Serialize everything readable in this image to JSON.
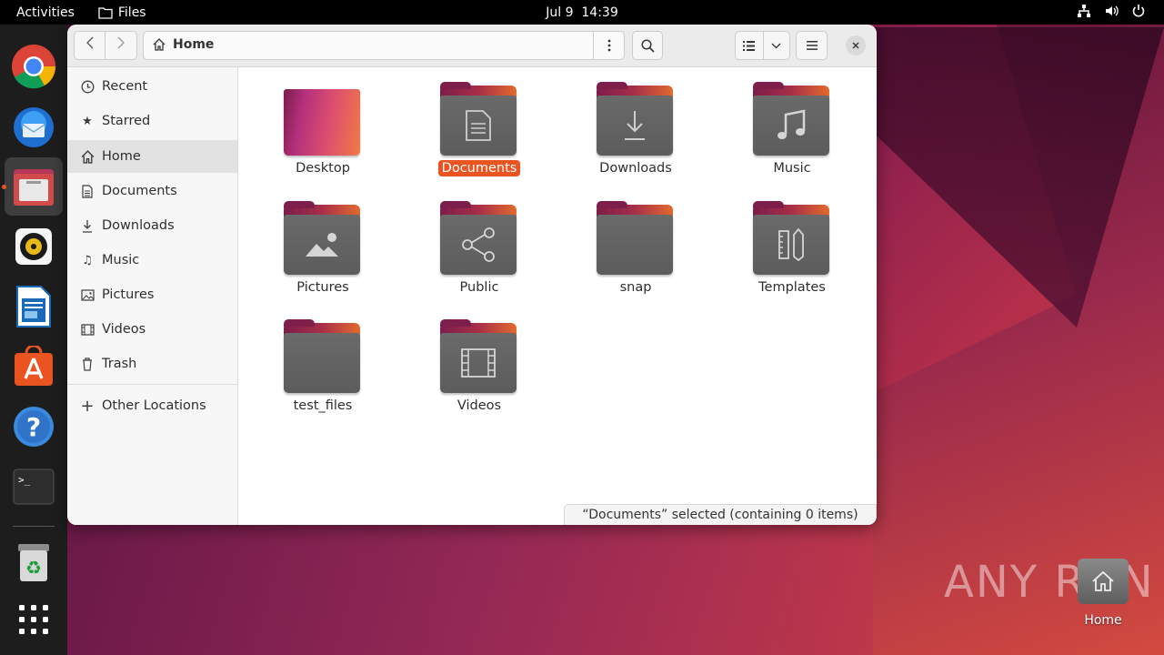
{
  "topbar": {
    "activities": "Activities",
    "app_name": "Files",
    "date": "Jul 9",
    "time": "14:39",
    "icons": [
      "network-icon",
      "volume-icon",
      "power-icon"
    ]
  },
  "dock": {
    "items": [
      "chrome",
      "thunderbird",
      "files",
      "rhythmbox",
      "libreoffice-writer",
      "app-center",
      "help",
      "terminal",
      "trash",
      "show-apps"
    ]
  },
  "window": {
    "path": "Home",
    "sidebar": [
      {
        "label": "Recent",
        "icon": "clock-icon"
      },
      {
        "label": "Starred",
        "icon": "star-icon"
      },
      {
        "label": "Home",
        "icon": "home-icon",
        "selected": true
      },
      {
        "label": "Documents",
        "icon": "document-icon"
      },
      {
        "label": "Downloads",
        "icon": "download-icon"
      },
      {
        "label": "Music",
        "icon": "music-icon"
      },
      {
        "label": "Pictures",
        "icon": "picture-icon"
      },
      {
        "label": "Videos",
        "icon": "video-icon"
      },
      {
        "label": "Trash",
        "icon": "trash-icon"
      }
    ],
    "other_locations": "Other Locations",
    "folders": [
      {
        "name": "Desktop",
        "emblem": ""
      },
      {
        "name": "Documents",
        "emblem": "document",
        "selected": true
      },
      {
        "name": "Downloads",
        "emblem": "download"
      },
      {
        "name": "Music",
        "emblem": "music"
      },
      {
        "name": "Pictures",
        "emblem": "picture"
      },
      {
        "name": "Public",
        "emblem": "share"
      },
      {
        "name": "snap",
        "emblem": ""
      },
      {
        "name": "Templates",
        "emblem": "template"
      },
      {
        "name": "test_files",
        "emblem": ""
      },
      {
        "name": "Videos",
        "emblem": "video"
      }
    ],
    "status": "“Documents” selected (containing 0 items)"
  },
  "desktop": {
    "home_label": "Home",
    "watermark": "ANY RUN"
  },
  "colors": {
    "accent": "#e95420",
    "panel": "#000000",
    "dock": "#1d1d1d"
  }
}
